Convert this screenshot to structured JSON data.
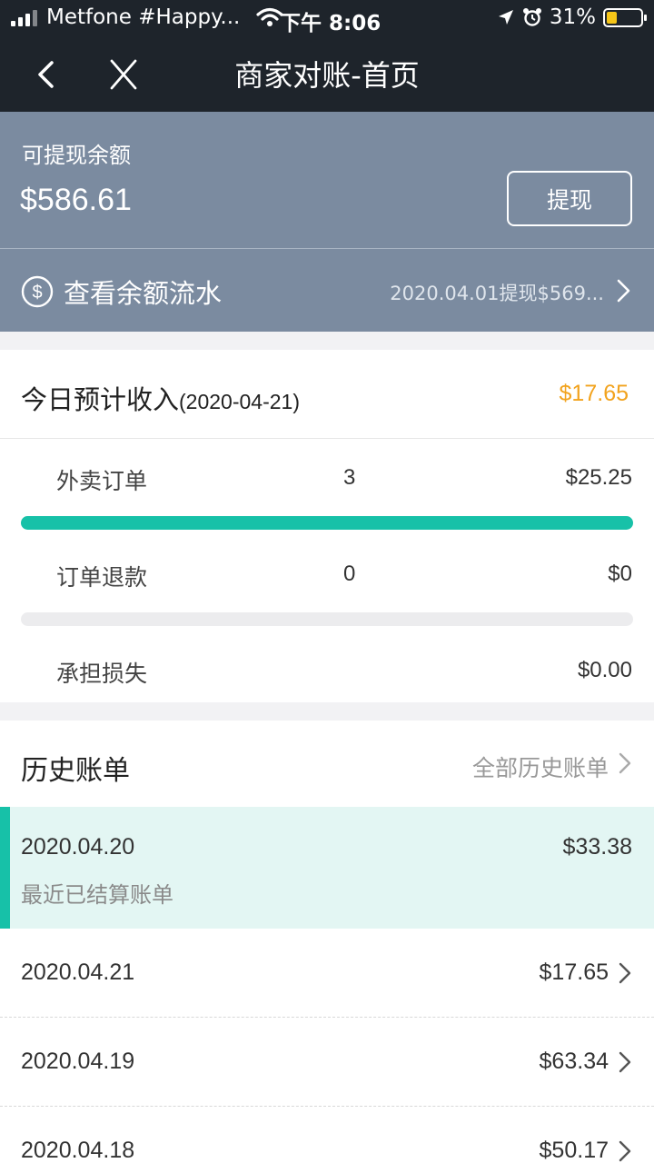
{
  "status_bar": {
    "carrier": "Metfone #Happy...",
    "time": "下午 8:06",
    "battery": "31%",
    "battery_level": 0.31
  },
  "nav": {
    "title": "商家对账-首页",
    "back_icon": "chevron-left-icon",
    "close_icon": "close-icon"
  },
  "balance": {
    "label": "可提现余额",
    "amount": "$586.61",
    "withdraw_label": "提现"
  },
  "flow": {
    "icon": "dollar-circle-icon",
    "label": "查看余额流水",
    "latest": "2020.04.01提现$569..."
  },
  "today": {
    "title": "今日预计收入",
    "date": "(2020-04-21)",
    "total": "$17.65",
    "rows": [
      {
        "label": "外卖订单",
        "count": "3",
        "amount": "$25.25",
        "fill": 1.0
      },
      {
        "label": "订单退款",
        "count": "0",
        "amount": "$0",
        "fill": 0.0
      },
      {
        "label": "承担损失",
        "amount": "$0.00"
      }
    ]
  },
  "history": {
    "title": "历史账单",
    "all_label": "全部历史账单",
    "recent": {
      "date": "2020.04.20",
      "amount": "$33.38",
      "note": "最近已结算账单"
    },
    "bills": [
      {
        "date": "2020.04.21",
        "amount": "$17.65"
      },
      {
        "date": "2020.04.19",
        "amount": "$63.34"
      },
      {
        "date": "2020.04.18",
        "amount": "$50.17"
      }
    ]
  },
  "colors": {
    "header_bg": "#1e242b",
    "balance_bg": "#7b8ba0",
    "accent": "#17c1a8",
    "highlight": "#f2a31e"
  }
}
